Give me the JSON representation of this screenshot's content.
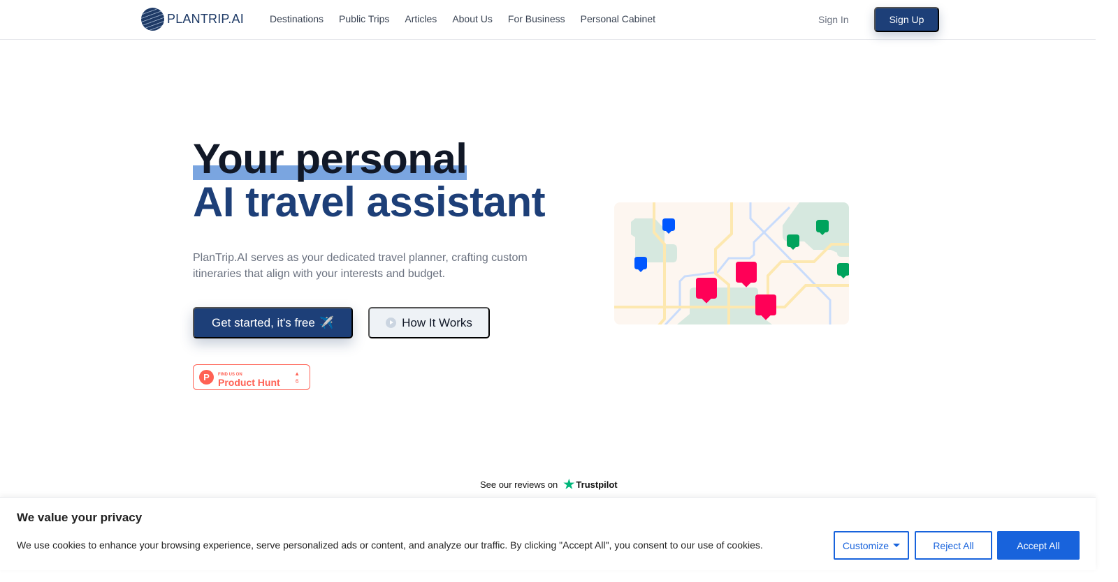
{
  "header": {
    "logo_text": "PLANTRIP.AI",
    "nav": [
      "Destinations",
      "Public Trips",
      "Articles",
      "About Us",
      "For Business",
      "Personal Cabinet"
    ],
    "sign_in": "Sign In",
    "sign_up": "Sign Up"
  },
  "hero": {
    "title_line1": "Your personal",
    "title_line2": "AI travel assistant",
    "description": "PlanTrip.AI serves as your dedicated travel planner, crafting custom itineraries that align with your interests and budget.",
    "cta": "Get started, it's free",
    "cta_icon": "✈️",
    "how_it_works": "How It Works"
  },
  "product_hunt": {
    "small": "FIND US ON",
    "big": "Product Hunt",
    "votes": "6",
    "logo": "P"
  },
  "trustpilot": {
    "text": "See our reviews on",
    "brand": "Trustpilot"
  },
  "cookie": {
    "title": "We value your privacy",
    "text": "We use cookies to enhance your browsing experience, serve personalized ads or content, and analyze our traffic. By clicking \"Accept All\", you consent to our use of cookies.",
    "customize": "Customize",
    "reject": "Reject All",
    "accept": "Accept All"
  },
  "colors": {
    "brand": "#1d3f78",
    "accent": "#1863dc",
    "product_hunt": "#ff6154",
    "pin_red": "#ff0057",
    "pin_blue": "#0057ff",
    "pin_green": "#00a35c"
  }
}
